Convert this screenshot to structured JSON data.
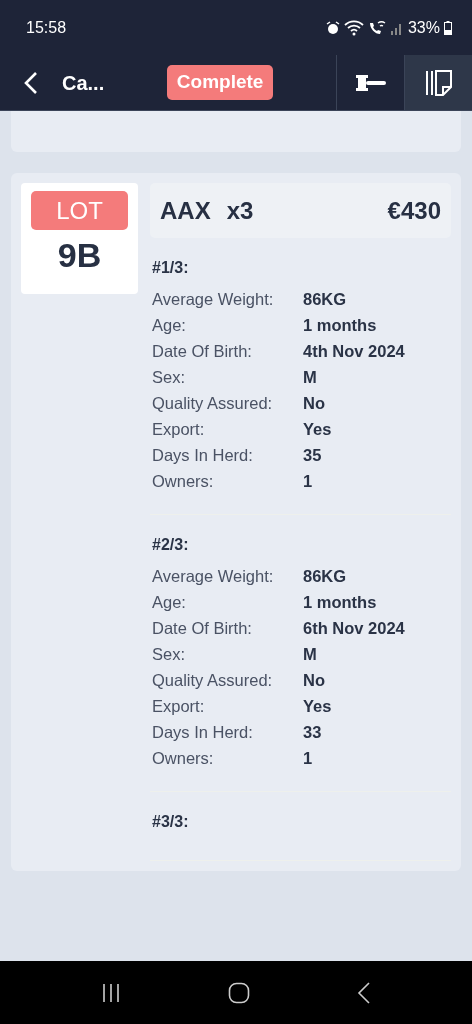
{
  "status_bar": {
    "time": "15:58",
    "battery": "33%"
  },
  "header": {
    "title": "Ca...",
    "status_badge": "Complete"
  },
  "lot": {
    "label": "LOT",
    "number": "9B",
    "breed": "AAX",
    "quantity": "x3",
    "price": "€430",
    "animals": [
      {
        "title": "#1/3:",
        "fields": [
          {
            "label": "Average Weight:",
            "value": "86KG"
          },
          {
            "label": "Age:",
            "value": "1 months"
          },
          {
            "label": "Date Of Birth:",
            "value": "4th Nov 2024"
          },
          {
            "label": "Sex:",
            "value": "M"
          },
          {
            "label": "Quality Assured:",
            "value": "No"
          },
          {
            "label": "Export:",
            "value": "Yes"
          },
          {
            "label": "Days In Herd:",
            "value": "35"
          },
          {
            "label": "Owners:",
            "value": "1"
          }
        ]
      },
      {
        "title": "#2/3:",
        "fields": [
          {
            "label": "Average Weight:",
            "value": "86KG"
          },
          {
            "label": "Age:",
            "value": "1 months"
          },
          {
            "label": "Date Of Birth:",
            "value": "6th Nov 2024"
          },
          {
            "label": "Sex:",
            "value": "M"
          },
          {
            "label": "Quality Assured:",
            "value": "No"
          },
          {
            "label": "Export:",
            "value": "Yes"
          },
          {
            "label": "Days In Herd:",
            "value": "33"
          },
          {
            "label": "Owners:",
            "value": "1"
          }
        ]
      },
      {
        "title": "#3/3:"
      }
    ]
  }
}
